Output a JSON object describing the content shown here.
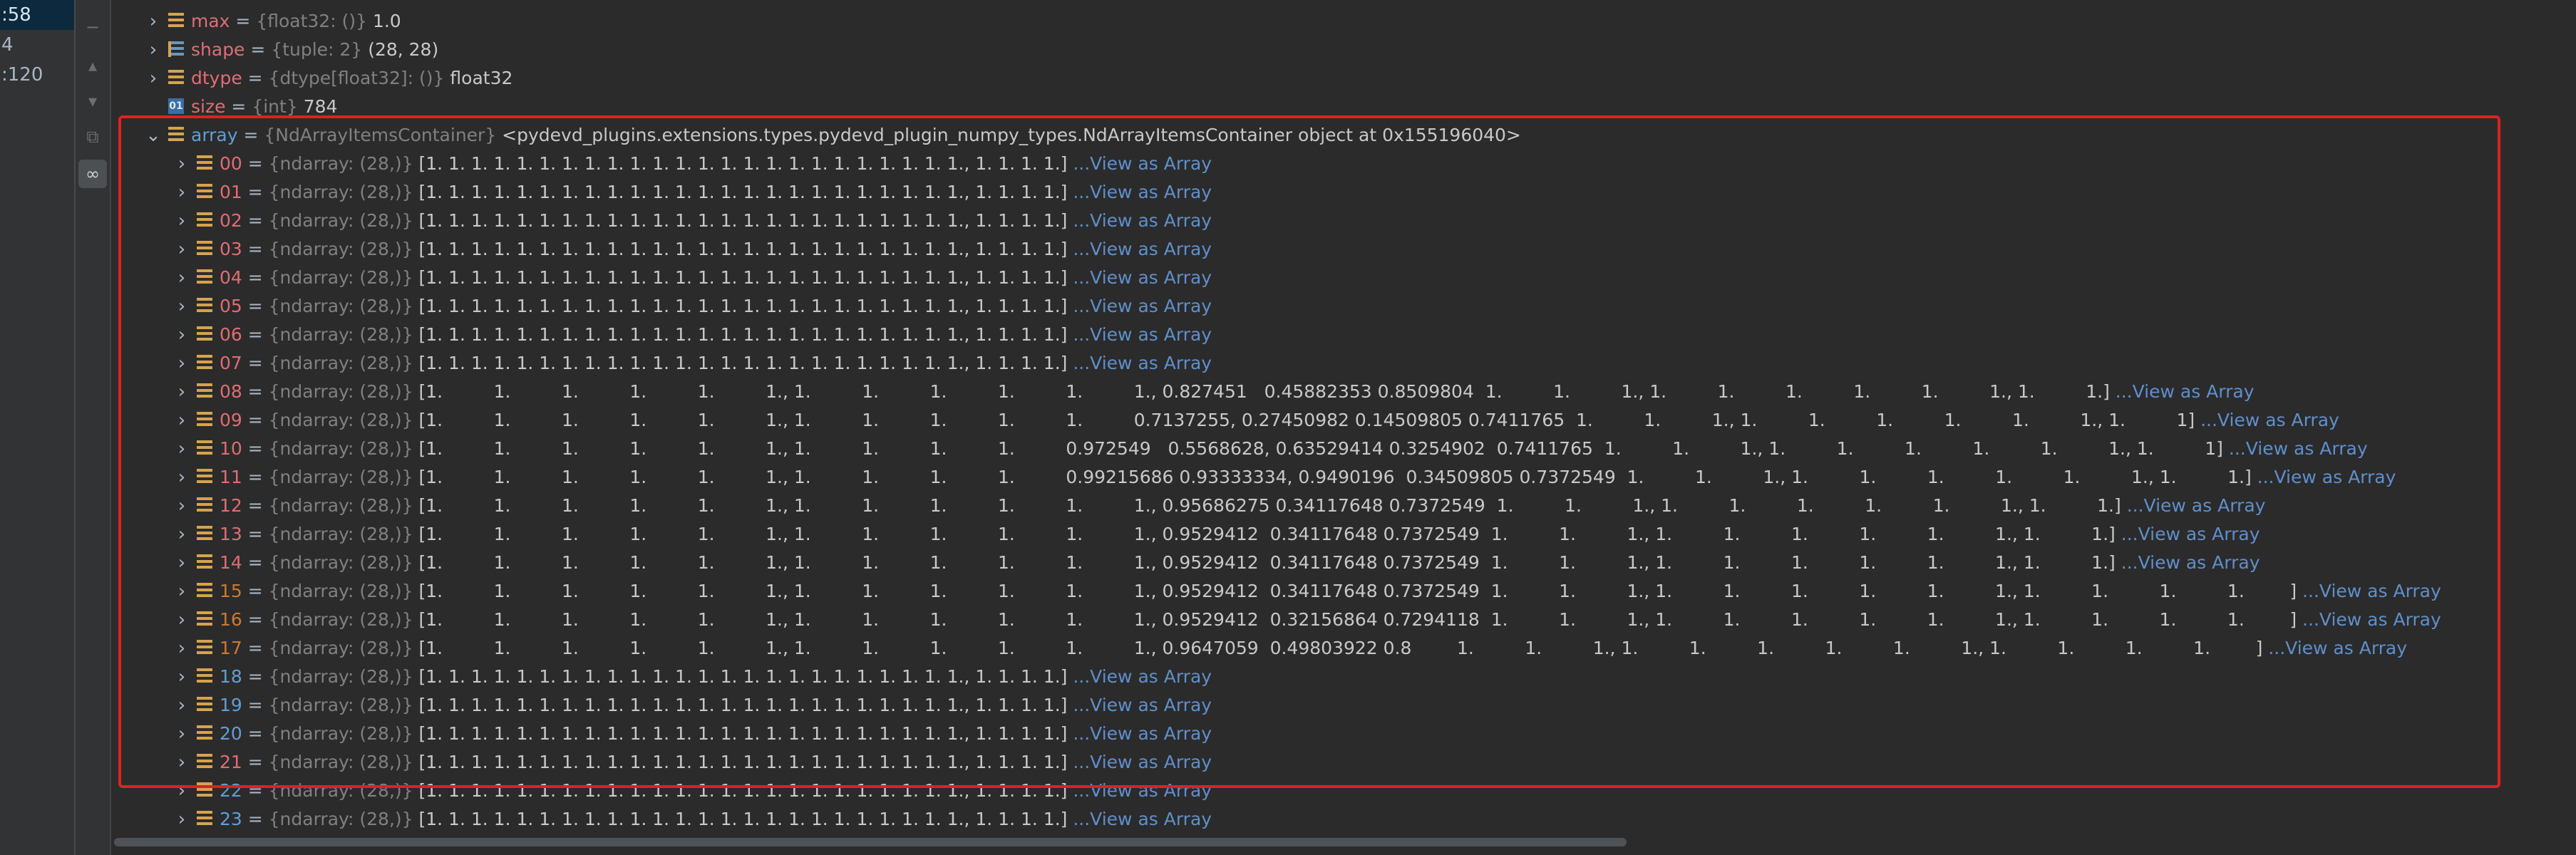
{
  "frames": [
    ":58",
    "4",
    ":120"
  ],
  "toolbar_icons": [
    "minus-icon",
    "up-icon",
    "down-icon",
    "copy-icon",
    "glasses-icon"
  ],
  "vars": [
    {
      "name": "max",
      "type": "{float32: ()}",
      "value": "1.0",
      "icon": "field",
      "color": "red",
      "arrow": "›"
    },
    {
      "name": "shape",
      "type": "{tuple: 2}",
      "value": "(28, 28)",
      "icon": "tuple",
      "color": "red",
      "arrow": "›"
    },
    {
      "name": "dtype",
      "type": "{dtype[float32]: ()}",
      "value": "float32",
      "icon": "field",
      "color": "red",
      "arrow": "›"
    },
    {
      "name": "size",
      "type": "{int}",
      "value": "784",
      "icon": "int",
      "color": "red",
      "arrow": ""
    },
    {
      "name": "array",
      "type": "{NdArrayItemsContainer}",
      "value": "<pydevd_plugins.extensions.types.pydevd_plugin_numpy_types.NdArrayItemsContainer object at 0x155196040>",
      "icon": "field",
      "color": "blue",
      "arrow": "⌄"
    }
  ],
  "children_type": "{ndarray: (28,)}",
  "view_link": "...View as Array",
  "children": [
    {
      "name": "00",
      "color": "red",
      "value": "[1. 1. 1. 1. 1. 1. 1. 1. 1. 1. 1. 1. 1. 1. 1. 1. 1. 1. 1. 1. 1. 1. 1. 1., 1. 1. 1. 1.]"
    },
    {
      "name": "01",
      "color": "red",
      "value": "[1. 1. 1. 1. 1. 1. 1. 1. 1. 1. 1. 1. 1. 1. 1. 1. 1. 1. 1. 1. 1. 1. 1. 1., 1. 1. 1. 1.]"
    },
    {
      "name": "02",
      "color": "red",
      "value": "[1. 1. 1. 1. 1. 1. 1. 1. 1. 1. 1. 1. 1. 1. 1. 1. 1. 1. 1. 1. 1. 1. 1. 1., 1. 1. 1. 1.]"
    },
    {
      "name": "03",
      "color": "red",
      "value": "[1. 1. 1. 1. 1. 1. 1. 1. 1. 1. 1. 1. 1. 1. 1. 1. 1. 1. 1. 1. 1. 1. 1. 1., 1. 1. 1. 1.]"
    },
    {
      "name": "04",
      "color": "red",
      "value": "[1. 1. 1. 1. 1. 1. 1. 1. 1. 1. 1. 1. 1. 1. 1. 1. 1. 1. 1. 1. 1. 1. 1. 1., 1. 1. 1. 1.]"
    },
    {
      "name": "05",
      "color": "red",
      "value": "[1. 1. 1. 1. 1. 1. 1. 1. 1. 1. 1. 1. 1. 1. 1. 1. 1. 1. 1. 1. 1. 1. 1. 1., 1. 1. 1. 1.]"
    },
    {
      "name": "06",
      "color": "red",
      "value": "[1. 1. 1. 1. 1. 1. 1. 1. 1. 1. 1. 1. 1. 1. 1. 1. 1. 1. 1. 1. 1. 1. 1. 1., 1. 1. 1. 1.]"
    },
    {
      "name": "07",
      "color": "red",
      "value": "[1. 1. 1. 1. 1. 1. 1. 1. 1. 1. 1. 1. 1. 1. 1. 1. 1. 1. 1. 1. 1. 1. 1. 1., 1. 1. 1. 1.]"
    },
    {
      "name": "08",
      "color": "red",
      "value": "[1.         1.         1.         1.         1.         1., 1.         1.         1.         1.         1.         1., 0.827451   0.45882353 0.8509804  1.         1.         1., 1.         1.         1.         1.         1.         1., 1.         1.]"
    },
    {
      "name": "09",
      "color": "red",
      "value": "[1.         1.         1.         1.         1.         1., 1.         1.         1.         1.         1.         0.7137255, 0.27450982 0.14509805 0.7411765  1.         1.         1., 1.         1.         1.         1.         1.         1., 1.         1]"
    },
    {
      "name": "10",
      "color": "red",
      "value": "[1.         1.         1.         1.         1.         1., 1.         1.         1.         1.         0.972549   0.5568628, 0.63529414 0.3254902  0.7411765  1.         1.         1., 1.         1.         1.         1.         1.         1., 1.         1]"
    },
    {
      "name": "11",
      "color": "red",
      "value": "[1.         1.         1.         1.         1.         1., 1.         1.         1.         1.         0.99215686 0.93333334, 0.9490196  0.34509805 0.7372549  1.         1.         1., 1.         1.         1.         1.         1.         1., 1.         1.]"
    },
    {
      "name": "12",
      "color": "red",
      "value": "[1.         1.         1.         1.         1.         1., 1.         1.         1.         1.         1.         1., 0.95686275 0.34117648 0.7372549  1.         1.         1., 1.         1.         1.         1.         1.         1., 1.         1.]"
    },
    {
      "name": "13",
      "color": "red",
      "value": "[1.         1.         1.         1.         1.         1., 1.         1.         1.         1.         1.         1., 0.9529412  0.34117648 0.7372549  1.         1.         1., 1.         1.         1.         1.         1.         1., 1.         1.]"
    },
    {
      "name": "14",
      "color": "red",
      "value": "[1.         1.         1.         1.         1.         1., 1.         1.         1.         1.         1.         1., 0.9529412  0.34117648 0.7372549  1.         1.         1., 1.         1.         1.         1.         1.         1., 1.         1.]"
    },
    {
      "name": "15",
      "color": "orange",
      "value": "[1.         1.         1.         1.         1.         1., 1.         1.         1.         1.         1.         1., 0.9529412  0.34117648 0.7372549  1.         1.         1., 1.         1.         1.         1.         1.         1., 1.         1.         1.         1.        ]"
    },
    {
      "name": "16",
      "color": "orange",
      "value": "[1.         1.         1.         1.         1.         1., 1.         1.         1.         1.         1.         1., 0.9529412  0.32156864 0.7294118  1.         1.         1., 1.         1.         1.         1.         1.         1., 1.         1.         1.         1.        ]"
    },
    {
      "name": "17",
      "color": "orange",
      "value": "[1.         1.         1.         1.         1.         1., 1.         1.         1.         1.         1.         1., 0.9647059  0.49803922 0.8        1.         1.         1., 1.         1.         1.         1.         1.         1., 1.         1.         1.         1.        ]"
    },
    {
      "name": "18",
      "color": "blue",
      "value": "[1. 1. 1. 1. 1. 1. 1. 1. 1. 1. 1. 1. 1. 1. 1. 1. 1. 1. 1. 1. 1. 1. 1. 1., 1. 1. 1. 1.]"
    },
    {
      "name": "19",
      "color": "blue",
      "value": "[1. 1. 1. 1. 1. 1. 1. 1. 1. 1. 1. 1. 1. 1. 1. 1. 1. 1. 1. 1. 1. 1. 1. 1., 1. 1. 1. 1.]"
    },
    {
      "name": "20",
      "color": "blue",
      "value": "[1. 1. 1. 1. 1. 1. 1. 1. 1. 1. 1. 1. 1. 1. 1. 1. 1. 1. 1. 1. 1. 1. 1. 1., 1. 1. 1. 1.]"
    },
    {
      "name": "21",
      "color": "red",
      "value": "[1. 1. 1. 1. 1. 1. 1. 1. 1. 1. 1. 1. 1. 1. 1. 1. 1. 1. 1. 1. 1. 1. 1. 1., 1. 1. 1. 1.]"
    },
    {
      "name": "22",
      "color": "blue",
      "value": "[1. 1. 1. 1. 1. 1. 1. 1. 1. 1. 1. 1. 1. 1. 1. 1. 1. 1. 1. 1. 1. 1. 1. 1., 1. 1. 1. 1.]"
    },
    {
      "name": "23",
      "color": "blue",
      "value": "[1. 1. 1. 1. 1. 1. 1. 1. 1. 1. 1. 1. 1. 1. 1. 1. 1. 1. 1. 1. 1. 1. 1. 1., 1. 1. 1. 1.]"
    }
  ]
}
